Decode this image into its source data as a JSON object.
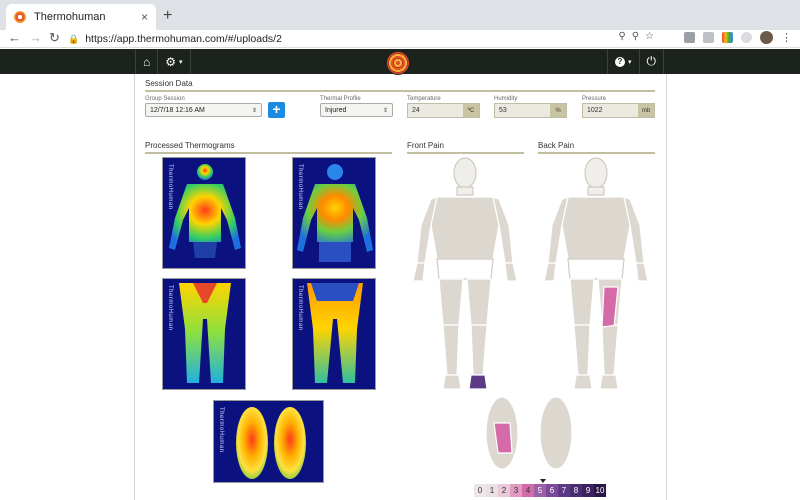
{
  "browser": {
    "tab_title": "Thermohuman",
    "tab_close": "×",
    "new_tab": "+",
    "url": "https://app.thermohuman.com/#/uploads/2"
  },
  "session": {
    "title": "Session Data",
    "group_session_label": "Group Session",
    "group_session_value": "12/7/18 12:16 AM",
    "add_label": "+",
    "thermal_profile_label": "Thermal Profile",
    "thermal_profile_value": "Injured",
    "temperature_label": "Temperature",
    "temperature_value": "24",
    "temperature_unit": "ºC",
    "humidity_label": "Humidity",
    "humidity_value": "53",
    "humidity_unit": "%",
    "pressure_label": "Pressure",
    "pressure_value": "1022",
    "pressure_unit": "mb"
  },
  "panels": {
    "processed_title": "Processed Thermograms",
    "front_pain_title": "Front Pain",
    "back_pain_title": "Back Pain",
    "thermogram_brand": "ThermoHuman"
  },
  "pain_scale": {
    "labels": [
      "0",
      "1",
      "2",
      "3",
      "4",
      "5",
      "6",
      "7",
      "8",
      "9",
      "10"
    ],
    "colors": [
      "#ece6e8",
      "#ecdfe4",
      "#e9c9d7",
      "#e29ac0",
      "#d46aa7",
      "#9a61a8",
      "#7b4a98",
      "#5e3a85",
      "#4b2e72",
      "#3a2360",
      "#2a1747"
    ],
    "text_colors": [
      "#333",
      "#333",
      "#333",
      "#333",
      "#333",
      "#fff",
      "#fff",
      "#fff",
      "#fff",
      "#fff",
      "#fff"
    ],
    "selected_index": 5
  },
  "colors": {
    "appbar": "#1c231d",
    "accent_blue": "#1a8be0",
    "pain_front_foot": "#5e3a85",
    "pain_back_thigh": "#d46aa7",
    "pain_sole": "#d46aa7"
  }
}
